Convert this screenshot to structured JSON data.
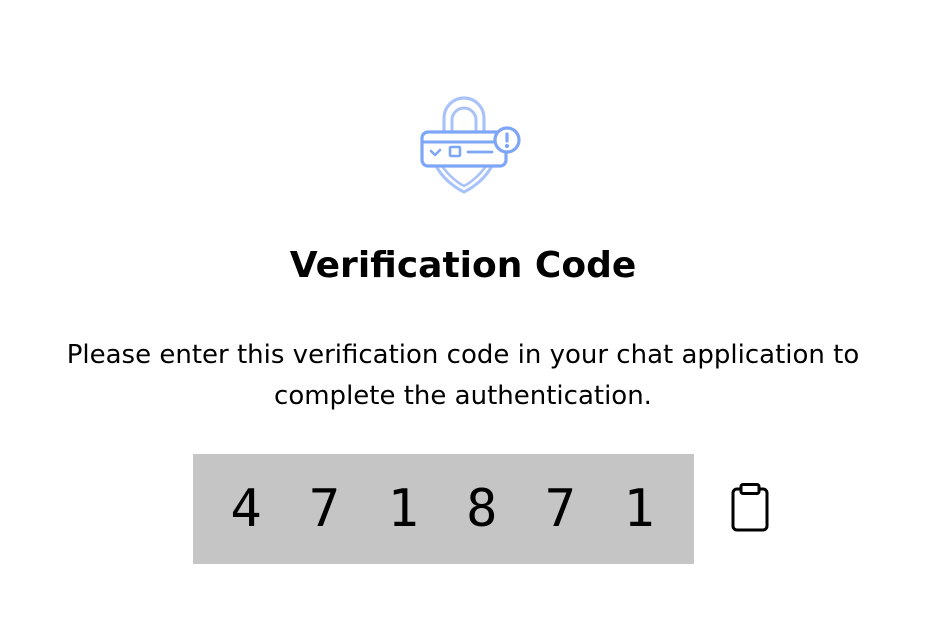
{
  "header": {
    "icon": "shield-lock-alert-icon"
  },
  "title": "Verification Code",
  "description": "Please enter this verification code in your chat application to complete the authentication.",
  "code": {
    "value": "4 7 1 8 7 1",
    "copy_icon": "clipboard-icon"
  },
  "colors": {
    "icon_accent": "#7EA6F6",
    "icon_secondary": "#A9C3F9",
    "code_background": "#C5C5C5",
    "text": "#000000"
  }
}
